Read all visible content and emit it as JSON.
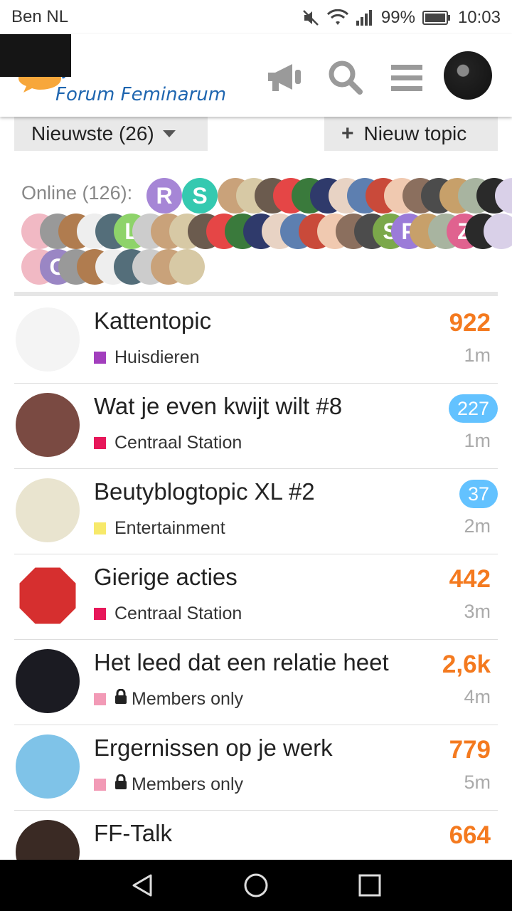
{
  "status_bar": {
    "carrier": "Ben NL",
    "battery": "99%",
    "time": "10:03"
  },
  "header": {
    "logo_text": "Forum Feminarum",
    "icons": [
      "megaphone-icon",
      "search-icon",
      "menu-icon"
    ]
  },
  "controls": {
    "filter_label": "Nieuwste (26)",
    "new_topic_label": "Nieuw topic"
  },
  "online": {
    "label": "Online (126):",
    "letter_avatars": [
      {
        "letter": "R",
        "color": "#a686d6"
      },
      {
        "letter": "S",
        "color": "#35c9b0"
      },
      {
        "letter": "L",
        "color": "#8ed36a"
      },
      {
        "letter": "S",
        "color": "#7ba84a"
      },
      {
        "letter": "P",
        "color": "#9b7bd8"
      },
      {
        "letter": "Z",
        "color": "#e0628f"
      },
      {
        "letter": "C",
        "color": "#9a86c4"
      }
    ]
  },
  "topics": [
    {
      "title": "Kattentopic",
      "category": "Huisdieren",
      "category_color": "#a23ebd",
      "locked": false,
      "count": "922",
      "count_style": "orange",
      "time": "1m",
      "avatar_color": "#f4f4f4"
    },
    {
      "title": "Wat je even kwijt wilt #8",
      "category": "Centraal Station",
      "category_color": "#e7175a",
      "locked": false,
      "count": "227",
      "count_style": "badge",
      "time": "1m",
      "avatar_color": "#7a4a42"
    },
    {
      "title": "Beutyblogtopic XL #2",
      "category": "Entertainment",
      "category_color": "#f7e96a",
      "locked": false,
      "count": "37",
      "count_style": "badge",
      "time": "2m",
      "avatar_color": "#e9e4cf"
    },
    {
      "title": "Gierige acties",
      "category": "Centraal Station",
      "category_color": "#e7175a",
      "locked": false,
      "count": "442",
      "count_style": "orange",
      "time": "3m",
      "avatar_color": "#ffffff"
    },
    {
      "title": "Het leed dat een relatie heet",
      "category": "Members only",
      "category_color": "#f29ab6",
      "locked": true,
      "count": "2,6k",
      "count_style": "orange",
      "time": "4m",
      "avatar_color": "#1b1b22"
    },
    {
      "title": "Ergernissen op je werk",
      "category": "Members only",
      "category_color": "#f29ab6",
      "locked": true,
      "count": "779",
      "count_style": "orange",
      "time": "5m",
      "avatar_color": "#7fc3e8"
    },
    {
      "title": "FF-Talk",
      "category": "",
      "category_color": "#e7175a",
      "locked": false,
      "count": "664",
      "count_style": "orange",
      "time": "",
      "avatar_color": "#3a2a24"
    }
  ],
  "nav": {
    "icons": [
      "back-icon",
      "home-icon",
      "recents-icon"
    ]
  }
}
